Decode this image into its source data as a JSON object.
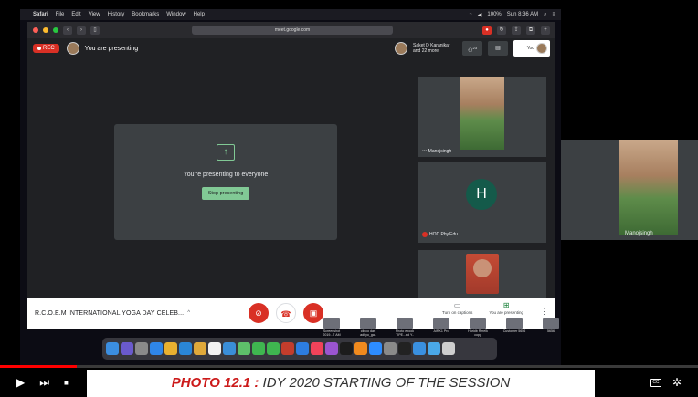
{
  "menubar": {
    "app": "Safari",
    "items": [
      "File",
      "Edit",
      "View",
      "History",
      "Bookmarks",
      "Window",
      "Help"
    ],
    "battery": "100%",
    "clock": "Sun 8:36 AM"
  },
  "browser": {
    "url": "meet.google.com"
  },
  "meet": {
    "rec_label": "REC",
    "presenting_label": "You are presenting",
    "host_name": "Saket D Karanikar",
    "host_more": "and 22 more",
    "participant_count": "23",
    "you_label": "You",
    "present_message": "You're presenting to everyone",
    "stop_label": "Stop presenting",
    "tile_mano_name": "Manojsingh",
    "tile_hod_name": "HOD Phy.Edu",
    "tile_hod_initial": "H",
    "meeting_title": "R.C.O.E.M INTERNATIONAL YOGA DAY CELEB...",
    "captions_label": "Turn on captions",
    "you_are_presenting": "You are presenting"
  },
  "desktop_files": [
    {
      "name": "Screenshot 2019...7 AM"
    },
    {
      "name": "clinco dart adhyo_ga.."
    },
    {
      "name": "Photo ebook TIPE...ed Y.."
    },
    {
      "name": "AIRK1 Pro"
    },
    {
      "name": "Haridb Rmeik copy"
    },
    {
      "name": "Customer 5656"
    },
    {
      "name": "5656"
    },
    {
      "name": "K1 STUD..8JK"
    }
  ],
  "dock_icons": [
    {
      "icon": "finder-icon",
      "color": "#3b8ee0"
    },
    {
      "icon": "siri-icon",
      "color": "#6a5acd"
    },
    {
      "icon": "launchpad-icon",
      "color": "#8a8a8a"
    },
    {
      "icon": "safari-icon",
      "color": "#2f86e8"
    },
    {
      "icon": "chrome-icon",
      "color": "#e8b030"
    },
    {
      "icon": "photos-icon",
      "color": "#2a86d6"
    },
    {
      "icon": "notes-icon",
      "color": "#e0a93a"
    },
    {
      "icon": "calendar-icon",
      "color": "#f2f2f2"
    },
    {
      "icon": "folder-icon",
      "color": "#3a8ed8"
    },
    {
      "icon": "maps-icon",
      "color": "#5ec06a"
    },
    {
      "icon": "facetime-icon",
      "color": "#3fb650"
    },
    {
      "icon": "messages-icon",
      "color": "#3fb650"
    },
    {
      "icon": "photo-booth-icon",
      "color": "#c33d2c"
    },
    {
      "icon": "app-store-icon",
      "color": "#2d7de0"
    },
    {
      "icon": "music-icon",
      "color": "#f0435a"
    },
    {
      "icon": "podcasts-icon",
      "color": "#9b55d0"
    },
    {
      "icon": "tv-icon",
      "color": "#1c1c1c"
    },
    {
      "icon": "books-icon",
      "color": "#f08a1e"
    },
    {
      "icon": "zoom-icon",
      "color": "#2d8cff"
    },
    {
      "icon": "preferences-icon",
      "color": "#8a8a8a"
    },
    {
      "icon": "terminal-icon",
      "color": "#222222"
    },
    {
      "icon": "mail-icon",
      "color": "#3a90e0"
    },
    {
      "icon": "downloads-icon",
      "color": "#4aa8e8"
    },
    {
      "icon": "trash-icon",
      "color": "#cfcfcf"
    }
  ],
  "external_tile": {
    "name": "Manojsingh"
  },
  "player": {
    "progress_fraction": 0.11,
    "cc": "CC"
  },
  "caption": {
    "lead": "PHOTO 12.1 :",
    "text": " IDY 2020 STARTING OF THE SESSION"
  }
}
